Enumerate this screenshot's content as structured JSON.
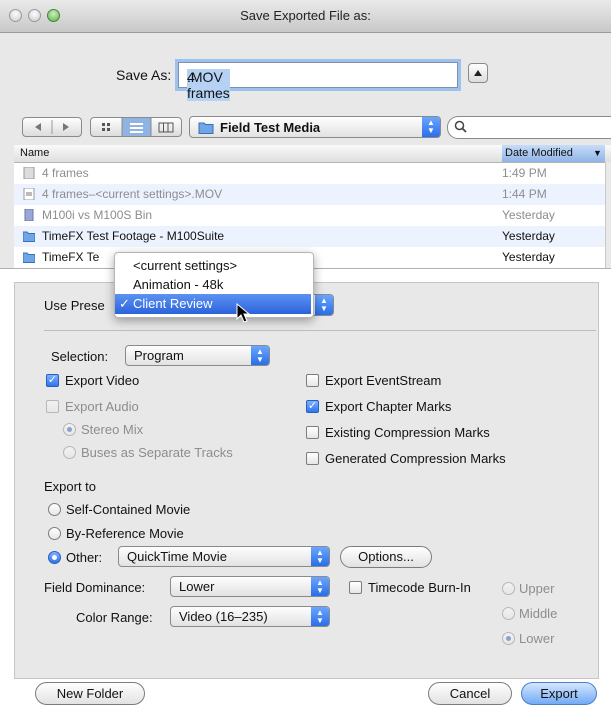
{
  "window": {
    "title": "Save Exported File as:"
  },
  "save_as": {
    "label": "Save As:",
    "value_selected": "4 frames",
    "value_ext": ".MOV"
  },
  "toolbar": {
    "location": "Field Test Media",
    "search_placeholder": ""
  },
  "list": {
    "col_name": "Name",
    "col_date": "Date Modified",
    "rows": [
      {
        "name": "4 frames",
        "date": "1:49 PM",
        "dim": true
      },
      {
        "name": "4 frames–<current settings>.MOV",
        "date": "1:44 PM",
        "dim": true
      },
      {
        "name": "M100i vs M100S Bin",
        "date": "Yesterday",
        "dim": true
      },
      {
        "name": "TimeFX Test Footage - M100Suite",
        "date": "Yesterday",
        "dim": false
      },
      {
        "name": "TimeFX Te",
        "date": "Yesterday",
        "dim": false
      }
    ]
  },
  "preset_menu": {
    "items": [
      "<current settings>",
      "Animation - 48k",
      "Client Review"
    ],
    "selected_index": 2,
    "check": "✓"
  },
  "options": {
    "use_preset_label": "Use Prese",
    "selection_label": "Selection:",
    "selection_value": "Program",
    "export_video": "Export Video",
    "export_audio": "Export Audio",
    "stereo_mix": "Stereo Mix",
    "buses": "Buses as Separate Tracks",
    "export_eventstream": "Export EventStream",
    "export_chapter_marks": "Export Chapter Marks",
    "existing_compression": "Existing Compression Marks",
    "generated_compression": "Generated Compression Marks",
    "export_to": "Export to",
    "self_contained": "Self-Contained Movie",
    "by_reference": "By-Reference Movie",
    "other": "Other:",
    "other_value": "QuickTime Movie",
    "options_button": "Options...",
    "field_dominance_label": "Field Dominance:",
    "field_dominance_value": "Lower",
    "timecode_burnin": "Timecode Burn-In",
    "upper": "Upper",
    "middle": "Middle",
    "lower": "Lower",
    "color_range_label": "Color Range:",
    "color_range_value": "Video (16–235)"
  },
  "buttons": {
    "new_folder": "New Folder",
    "cancel": "Cancel",
    "export": "Export"
  },
  "colors": {
    "accent": "#3a78e8",
    "selection": "#b5d2f5",
    "stripe": "#edf3fe"
  }
}
